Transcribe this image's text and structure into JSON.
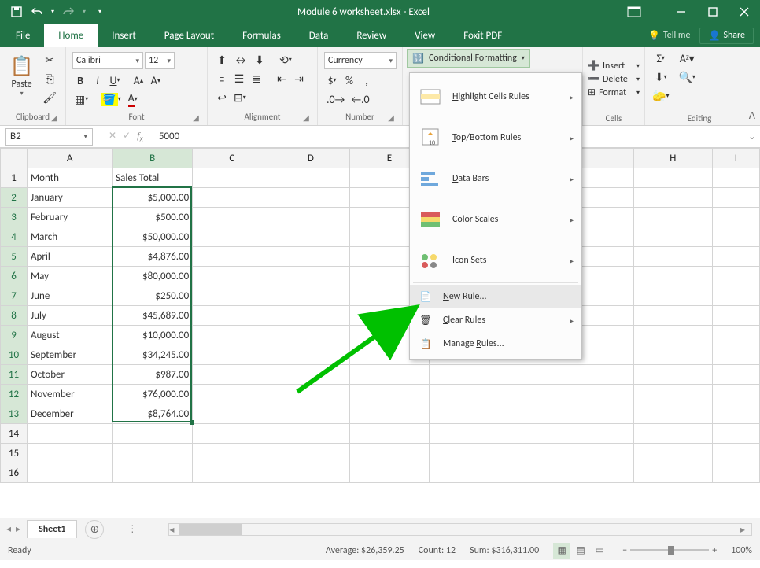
{
  "app": {
    "title": "Module 6 worksheet.xlsx - Excel"
  },
  "ribbon_tabs": [
    "File",
    "Home",
    "Insert",
    "Page Layout",
    "Formulas",
    "Data",
    "Review",
    "View",
    "Foxit PDF"
  ],
  "tell_me": "Tell me",
  "share": "Share",
  "groups": {
    "clipboard": "Clipboard",
    "font": "Font",
    "alignment": "Alignment",
    "number": "Number",
    "cells": "Cells",
    "editing": "Editing",
    "paste": "Paste"
  },
  "font": {
    "name": "Calibri",
    "size": "12"
  },
  "number_format": "Currency",
  "cf_button_label": "Conditional Formatting",
  "cf_menu": {
    "highlight": "Highlight Cells Rules",
    "topbottom": "Top/Bottom Rules",
    "databars": "Data Bars",
    "colorscales": "Color Scales",
    "iconsets": "Icon Sets",
    "newrule": "New Rule...",
    "clearrules": "Clear Rules",
    "managerules": "Manage Rules..."
  },
  "cells_group": {
    "insert": "Insert",
    "delete": "Delete",
    "format": "Format"
  },
  "name_box": "B2",
  "formula_value": "5000",
  "columns": [
    "A",
    "B",
    "C",
    "D",
    "E",
    "H",
    "I"
  ],
  "headers": {
    "A": "Month",
    "B": "Sales Total"
  },
  "rows": [
    {
      "n": 1,
      "A": "Month",
      "B": "Sales Total"
    },
    {
      "n": 2,
      "A": "January",
      "B": "$5,000.00"
    },
    {
      "n": 3,
      "A": "February",
      "B": "$500.00"
    },
    {
      "n": 4,
      "A": "March",
      "B": "$50,000.00"
    },
    {
      "n": 5,
      "A": "April",
      "B": "$4,876.00"
    },
    {
      "n": 6,
      "A": "May",
      "B": "$80,000.00"
    },
    {
      "n": 7,
      "A": "June",
      "B": "$250.00"
    },
    {
      "n": 8,
      "A": "July",
      "B": "$45,689.00"
    },
    {
      "n": 9,
      "A": "August",
      "B": "$10,000.00"
    },
    {
      "n": 10,
      "A": "September",
      "B": "$34,245.00"
    },
    {
      "n": 11,
      "A": "October",
      "B": "$987.00"
    },
    {
      "n": 12,
      "A": "November",
      "B": "$76,000.00"
    },
    {
      "n": 13,
      "A": "December",
      "B": "$8,764.00"
    },
    {
      "n": 14,
      "A": "",
      "B": ""
    },
    {
      "n": 15,
      "A": "",
      "B": ""
    },
    {
      "n": 16,
      "A": "",
      "B": ""
    }
  ],
  "sheet": {
    "name": "Sheet1"
  },
  "status": {
    "ready": "Ready",
    "average_label": "Average:",
    "average": "$26,359.25",
    "count_label": "Count:",
    "count": "12",
    "sum_label": "Sum:",
    "sum": "$316,311.00",
    "zoom": "100%"
  }
}
